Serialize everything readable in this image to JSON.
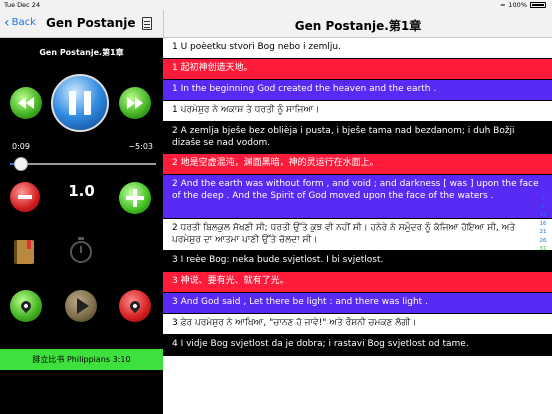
{
  "status": {
    "time": "Tue Dec 24",
    "battery": "100%"
  },
  "left_nav": {
    "back_label": "Back",
    "title": "Gen Postanje"
  },
  "right_nav": {
    "title": "Gen Postanje.第1章"
  },
  "player": {
    "subtitle": "Gen Postanje.第1章",
    "elapsed": "0:09",
    "remaining": "−5:03",
    "progress": 0.03,
    "speed": "1.0",
    "footer": "腓立比书 Philippians 3:10"
  },
  "verses": [
    {
      "text": "1 U poèetku stvori Bog nebo i zemlju.",
      "style": "white",
      "h": 1
    },
    {
      "text": "1 起初神创造天地。",
      "style": "red",
      "h": 1
    },
    {
      "text": "1 In the beginning God created the heaven and the earth .",
      "style": "blue",
      "h": 1
    },
    {
      "text": "1 ਪਰਮੇਸ਼ੁਰ ਨੇ ਅਕਾਸ਼ ਤੇ ਧਰਤੀ ਨੂੰ ਸਾਜਿਆ।",
      "style": "white",
      "h": 1
    },
    {
      "text": "2 A zemlja bješe bez oblièja i pusta, i bješe tama nad bezdanom; i duh Božji dizaše se nad vodom.",
      "style": "black",
      "h": 2
    },
    {
      "text": "2 地是空虚混沌，渊面黑暗，神的灵运行在水面上。",
      "style": "red",
      "h": 1
    },
    {
      "text": "2 And the earth was without form , and void ; and darkness [ was ] upon the face of the deep . And the Spirit of God moved upon the face of the waters .",
      "style": "blue",
      "h": 3
    },
    {
      "text": "2 ਧਰਤੀ ਬਿਲਕੁਲ ਸੱਖਣੀ ਸੀ; ਧਰਤੀ ਉੱਤੇ ਕੁਝ ਵੀ ਨਹੀਂ ਸੀ। ਹਨੇਰੇ ਨੇ ਸਮੁੰਦਰ ਨੂੰ ਕੱਜਿਆ ਹੋਇਆ ਸੀ, ਅਤੇ ਪਰਮੇਸ਼ੁਰ ਦਾ ਆਤਮਾ ਪਾਣੀ ਉੱਤੇ ਚੱਲਦਾ ਸੀ।",
      "style": "white",
      "h": 2
    },
    {
      "text": "3 I reèe Bog: neka bude svjetlost. I bi svjetlost.",
      "style": "black",
      "h": 1
    },
    {
      "text": "3 神说、要有光、就有了光。",
      "style": "red",
      "h": 1
    },
    {
      "text": "3 And God said , Let there be light : and there was light .",
      "style": "blue",
      "h": 1
    },
    {
      "text": "3 ਫ਼ੇਰ ਪਰਮੇਸ਼ੁਰ ਨੇ ਆਖਿਆ, \"ਚਾਨਣ ਹੋ ਜਾਵੇ!\" ਅਤੇ ਰੌਸ਼ਨੀ ਚਮਕਣ ਲੱਗੀ।",
      "style": "white",
      "h": 1
    },
    {
      "text": "4 I vidje Bog svjetlost da je dobra; i rastavi Bog svjetlost od tame.",
      "style": "black",
      "h": 1
    }
  ],
  "index_numbers": [
    "1",
    "6",
    "11",
    "16",
    "21",
    "26",
    "31"
  ],
  "icons": {
    "rewind": "rewind-icon",
    "pause": "pause-icon",
    "forward": "fast-forward-icon",
    "slower": "minus-icon",
    "faster": "plus-icon",
    "bookmark": "book-icon",
    "timer": "timer-icon",
    "location1": "map-pin-icon",
    "next": "arrow-right-icon",
    "location2": "map-pin-icon"
  }
}
